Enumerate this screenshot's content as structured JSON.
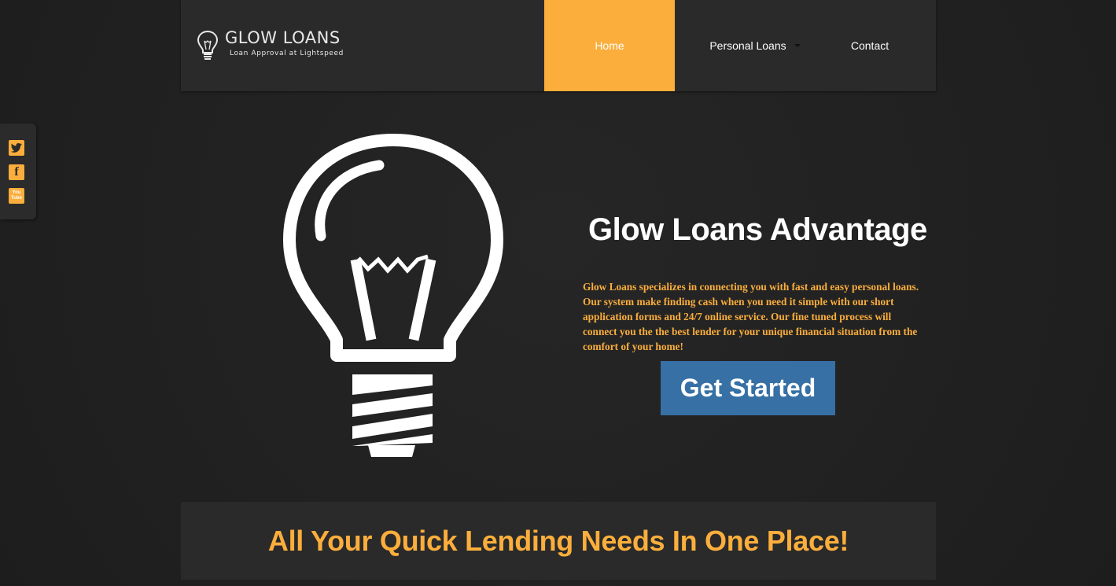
{
  "brand": {
    "title": "GLOW LOANS",
    "tagline": "Loan Approval at Lightspeed"
  },
  "nav": {
    "items": [
      {
        "label": "Home",
        "active": true
      },
      {
        "label": "Personal Loans",
        "has_dropdown": true
      },
      {
        "label": "Contact"
      }
    ]
  },
  "social": {
    "icons": [
      "twitter-icon",
      "facebook-icon",
      "youtube-icon"
    ],
    "youtube_lines": [
      "You",
      "Tube"
    ]
  },
  "hero": {
    "title": "Glow Loans Advantage",
    "description": "Glow Loans specializes in connecting you with fast and easy personal loans. Our system make finding cash when you need it simple with our short application forms and 24/7 online service.  Our fine tuned process will connect you the the best lender for your unique financial situation from the comfort of your home!",
    "cta_label": "Get Started"
  },
  "banner": {
    "text": "All Your Quick Lending Needs In One Place!"
  },
  "colors": {
    "accent": "#fbae3c",
    "button": "#3670a5",
    "background": "#222222",
    "panel": "#2a2a2a"
  }
}
